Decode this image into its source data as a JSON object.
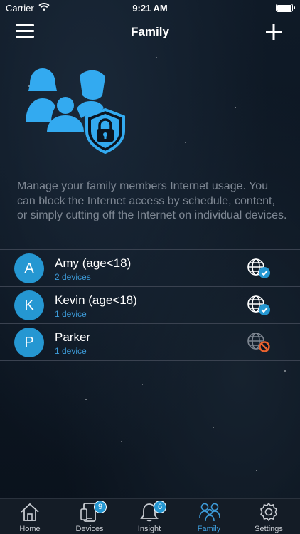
{
  "status_bar": {
    "carrier": "Carrier",
    "time": "9:21 AM"
  },
  "nav": {
    "title": "Family",
    "menu_icon": "hamburger-menu-icon",
    "add_icon": "plus-icon"
  },
  "hero": {
    "icon": "family-parental-control-icon",
    "accent": "#33aaf0"
  },
  "description": "Manage your family members Internet usage. You can block the Internet access by schedule, content, or simply cutting off the Internet on individual devices.",
  "members": [
    {
      "initial": "A",
      "name": "Amy (age<18)",
      "devices": "2 devices",
      "status_icon": "globe-allowed-icon"
    },
    {
      "initial": "K",
      "name": "Kevin (age<18)",
      "devices": "1 device",
      "status_icon": "globe-allowed-icon"
    },
    {
      "initial": "P",
      "name": "Parker",
      "devices": "1 device",
      "status_icon": "globe-blocked-icon"
    }
  ],
  "tabs": [
    {
      "label": "Home",
      "icon": "home-icon"
    },
    {
      "label": "Devices",
      "icon": "devices-icon",
      "badge": "9"
    },
    {
      "label": "Insight",
      "icon": "bell-icon",
      "badge": "6"
    },
    {
      "label": "Family",
      "icon": "family-icon",
      "active": true
    },
    {
      "label": "Settings",
      "icon": "gear-icon"
    }
  ],
  "colors": {
    "accent": "#3d9bd9",
    "avatar": "#2597d2",
    "allowed": "#2597d2",
    "blocked": "#e8622e",
    "background": "#0b1420"
  }
}
